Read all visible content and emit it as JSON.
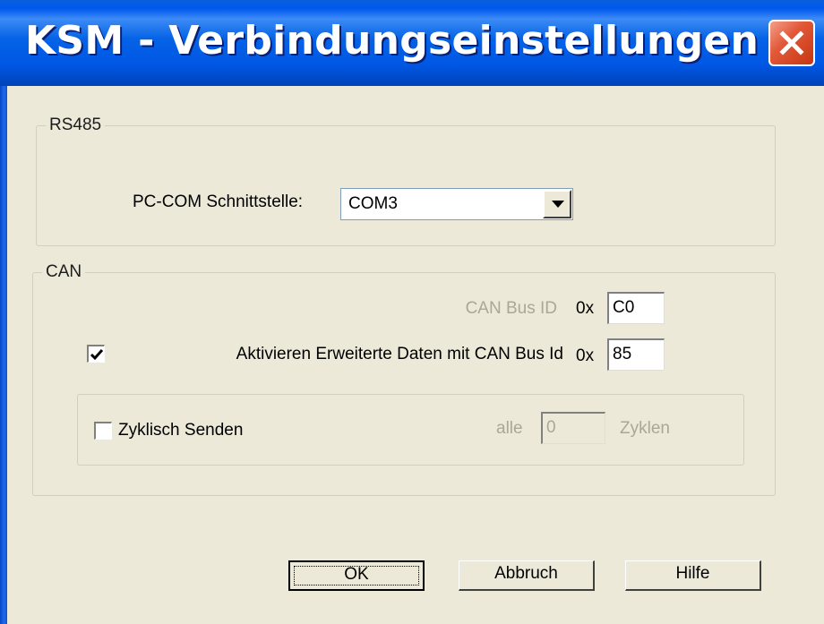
{
  "window": {
    "title": "KSM - Verbindungseinstellungen",
    "close_icon": "close-icon"
  },
  "rs485": {
    "legend": "RS485",
    "com_label": "PC-COM Schnittstelle:",
    "com_value": "COM3",
    "dropdown_icon": "chevron-down-icon"
  },
  "can": {
    "legend": "CAN",
    "bus_id_label": "CAN Bus ID",
    "bus_id_prefix": "0x",
    "bus_id_value": "C0",
    "extended_checked": true,
    "extended_label": "Aktivieren Erweiterte Daten mit CAN Bus Id",
    "extended_prefix": "0x",
    "extended_value": "85",
    "cyclic_checked": false,
    "cyclic_label": "Zyklisch Senden",
    "every_label": "alle",
    "cycles_value": "0",
    "cycles_label": "Zyklen"
  },
  "buttons": {
    "ok": "OK",
    "cancel": "Abbruch",
    "help": "Hilfe"
  },
  "colors": {
    "title_bar": "#0058EE",
    "dialog_background": "#ECE9D8",
    "close_button": "#E2593A",
    "disabled_text": "#A9A798"
  }
}
